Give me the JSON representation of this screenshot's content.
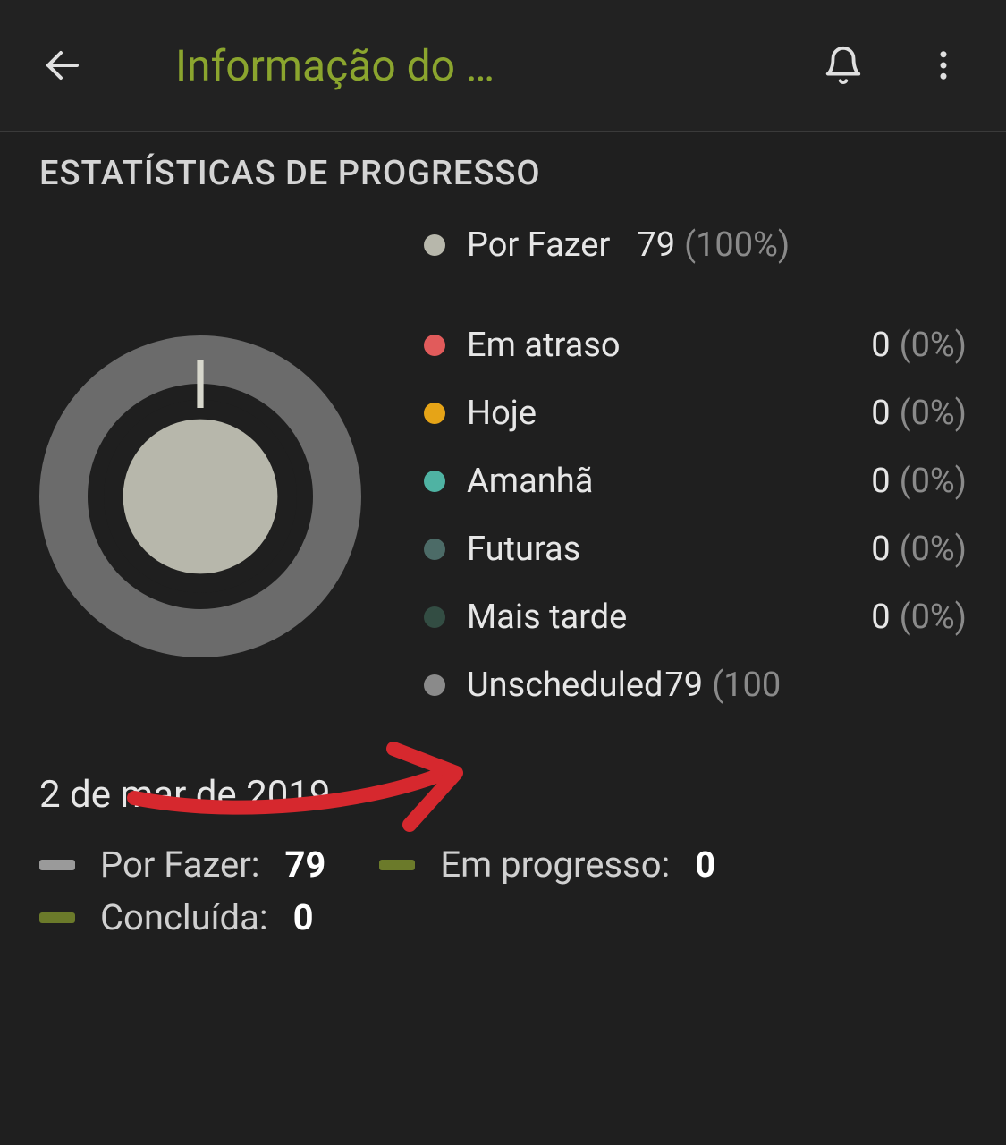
{
  "header": {
    "title": "Informação do …"
  },
  "section_title": "ESTATÍSTICAS DE PROGRESSO",
  "chart_data": {
    "type": "pie",
    "title": "Estatísticas de Progresso",
    "series": [
      {
        "name": "Por Fazer",
        "value": 79,
        "percent": 100,
        "color": "#b7b7ab"
      }
    ],
    "breakdown": [
      {
        "name": "Em atraso",
        "value": 0,
        "percent": 0,
        "color": "#e15b5b"
      },
      {
        "name": "Hoje",
        "value": 0,
        "percent": 0,
        "color": "#e6a417"
      },
      {
        "name": "Amanhã",
        "value": 0,
        "percent": 0,
        "color": "#4fb3a3"
      },
      {
        "name": "Futuras",
        "value": 0,
        "percent": 0,
        "color": "#4c6b67"
      },
      {
        "name": "Mais tarde",
        "value": 0,
        "percent": 0,
        "color": "#334d43"
      },
      {
        "name": "Unscheduled",
        "value": 79,
        "percent": 100,
        "color": "#8a8a8a"
      }
    ]
  },
  "legend": {
    "top": {
      "label": "Por Fazer",
      "value": "79",
      "percent": "(100%)",
      "color": "#b7b7ab"
    },
    "items": [
      {
        "label": "Em atraso",
        "value": "0",
        "percent": "(0%)",
        "color": "#e15b5b"
      },
      {
        "label": "Hoje",
        "value": "0",
        "percent": "(0%)",
        "color": "#e6a417"
      },
      {
        "label": "Amanhã",
        "value": "0",
        "percent": "(0%)",
        "color": "#4fb3a3"
      },
      {
        "label": "Futuras",
        "value": "0",
        "percent": "(0%)",
        "color": "#4c6b67"
      },
      {
        "label": "Mais tarde",
        "value": "0",
        "percent": "(0%)",
        "color": "#334d43"
      },
      {
        "label": "Unscheduled",
        "value": "79",
        "percent": "(100",
        "color": "#8a8a8a"
      }
    ]
  },
  "date_line": "2 de mar de 2019",
  "bottom": {
    "todo": {
      "label": "Por Fazer:",
      "value": "79",
      "color": "#9a9a9a"
    },
    "inprog": {
      "label": "Em progresso:",
      "value": "0",
      "color": "#6b7a2a"
    },
    "done": {
      "label": "Concluída:",
      "value": "0",
      "color": "#6b7a2a"
    }
  }
}
